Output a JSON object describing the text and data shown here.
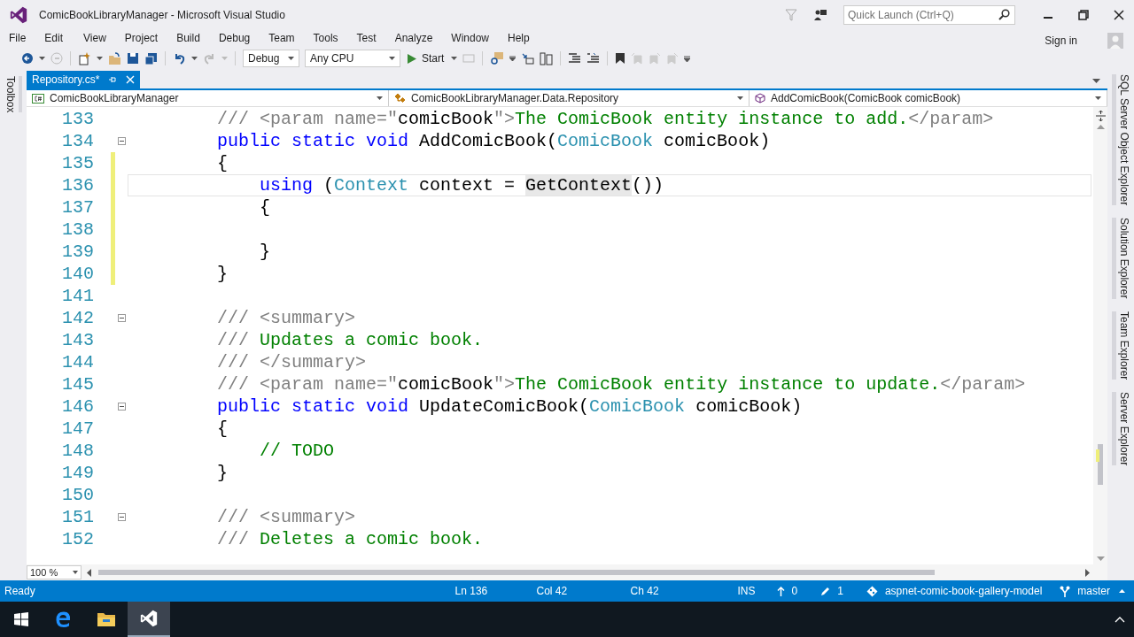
{
  "window": {
    "title": "ComicBookLibraryManager - Microsoft Visual Studio"
  },
  "quick_launch": {
    "placeholder": "Quick Launch (Ctrl+Q)"
  },
  "sign_in": "Sign in",
  "menu": [
    "File",
    "Edit",
    "View",
    "Project",
    "Build",
    "Debug",
    "Team",
    "Tools",
    "Test",
    "Analyze",
    "Window",
    "Help"
  ],
  "toolbar": {
    "configuration": "Debug",
    "platform": "Any CPU",
    "start": "Start"
  },
  "tabs": [
    {
      "label": "Repository.cs*",
      "selected": true
    }
  ],
  "navigation": {
    "project": "ComicBookLibraryManager",
    "type": "ComicBookLibraryManager.Data.Repository",
    "member": "AddComicBook(ComicBook comicBook)"
  },
  "left_panels": [
    "Toolbox"
  ],
  "right_panels": [
    "SQL Server Object Explorer",
    "Solution Explorer",
    "Team Explorer",
    "Server Explorer"
  ],
  "editor": {
    "zoom": "100 %",
    "lines": [
      {
        "number": "133",
        "changed": false,
        "current": false,
        "foldable": false,
        "kind": "member",
        "tokens": [
          {
            "kind": "doc",
            "text": "/// <param name=\""
          },
          {
            "kind": "plain",
            "text": "comicBook"
          },
          {
            "kind": "doc",
            "text": "\">"
          },
          {
            "kind": "comment",
            "text": "The ComicBook entity instance to add."
          },
          {
            "kind": "doc",
            "text": "</param>"
          }
        ]
      },
      {
        "number": "134",
        "changed": false,
        "current": false,
        "foldable": true,
        "kind": "member",
        "tokens": [
          {
            "kind": "keyword",
            "text": "public static void"
          },
          {
            "kind": "plain",
            "text": " AddComicBook("
          },
          {
            "kind": "type",
            "text": "ComicBook"
          },
          {
            "kind": "plain",
            "text": " comicBook)"
          }
        ]
      },
      {
        "number": "135",
        "changed": true,
        "current": false,
        "foldable": false,
        "kind": "member",
        "tokens": [
          {
            "kind": "plain",
            "text": "{"
          }
        ]
      },
      {
        "number": "136",
        "changed": true,
        "current": true,
        "foldable": false,
        "kind": "statement",
        "tokens": [
          {
            "kind": "keyword",
            "text": "using"
          },
          {
            "kind": "plain",
            "text": " ("
          },
          {
            "kind": "type",
            "text": "Context"
          },
          {
            "kind": "plain",
            "text": " context = "
          },
          {
            "kind": "highlight",
            "text": "GetContext"
          },
          {
            "kind": "plain",
            "text": "())"
          }
        ]
      },
      {
        "number": "137",
        "changed": true,
        "current": false,
        "foldable": false,
        "kind": "statement",
        "tokens": [
          {
            "kind": "plain",
            "text": "{"
          }
        ]
      },
      {
        "number": "138",
        "changed": true,
        "current": false,
        "foldable": false
      },
      {
        "number": "139",
        "changed": true,
        "current": false,
        "foldable": false,
        "kind": "statement",
        "tokens": [
          {
            "kind": "plain",
            "text": "}"
          }
        ]
      },
      {
        "number": "140",
        "changed": true,
        "current": false,
        "foldable": false,
        "kind": "member",
        "tokens": [
          {
            "kind": "plain",
            "text": "}"
          }
        ]
      },
      {
        "number": "141",
        "changed": false,
        "current": false,
        "foldable": false
      },
      {
        "number": "142",
        "changed": false,
        "current": false,
        "foldable": true,
        "kind": "member",
        "tokens": [
          {
            "kind": "doc",
            "text": "/// <summary>"
          }
        ]
      },
      {
        "number": "143",
        "changed": false,
        "current": false,
        "foldable": false,
        "kind": "member",
        "tokens": [
          {
            "kind": "doc",
            "text": "/// "
          },
          {
            "kind": "comment",
            "text": "Updates a comic book."
          }
        ]
      },
      {
        "number": "144",
        "changed": false,
        "current": false,
        "foldable": false,
        "kind": "member",
        "tokens": [
          {
            "kind": "doc",
            "text": "/// </summary>"
          }
        ]
      },
      {
        "number": "145",
        "changed": false,
        "current": false,
        "foldable": false,
        "kind": "member",
        "tokens": [
          {
            "kind": "doc",
            "text": "/// <param name=\""
          },
          {
            "kind": "plain",
            "text": "comicBook"
          },
          {
            "kind": "doc",
            "text": "\">"
          },
          {
            "kind": "comment",
            "text": "The ComicBook entity instance to update."
          },
          {
            "kind": "doc",
            "text": "</param>"
          }
        ]
      },
      {
        "number": "146",
        "changed": false,
        "current": false,
        "foldable": true,
        "kind": "member",
        "tokens": [
          {
            "kind": "keyword",
            "text": "public static void"
          },
          {
            "kind": "plain",
            "text": " UpdateComicBook("
          },
          {
            "kind": "type",
            "text": "ComicBook"
          },
          {
            "kind": "plain",
            "text": " comicBook)"
          }
        ]
      },
      {
        "number": "147",
        "changed": false,
        "current": false,
        "foldable": false,
        "kind": "member",
        "tokens": [
          {
            "kind": "plain",
            "text": "{"
          }
        ]
      },
      {
        "number": "148",
        "changed": false,
        "current": false,
        "foldable": false,
        "kind": "statement",
        "tokens": [
          {
            "kind": "comment",
            "text": "// TODO"
          }
        ]
      },
      {
        "number": "149",
        "changed": false,
        "current": false,
        "foldable": false,
        "kind": "member",
        "tokens": [
          {
            "kind": "plain",
            "text": "}"
          }
        ]
      },
      {
        "number": "150",
        "changed": false,
        "current": false,
        "foldable": false
      },
      {
        "number": "151",
        "changed": false,
        "current": false,
        "foldable": true,
        "kind": "member",
        "tokens": [
          {
            "kind": "doc",
            "text": "/// <summary>"
          }
        ]
      },
      {
        "number": "152",
        "changed": false,
        "current": false,
        "foldable": false,
        "kind": "member",
        "tokens": [
          {
            "kind": "doc",
            "text": "/// "
          },
          {
            "kind": "comment",
            "text": "Deletes a comic book."
          }
        ]
      }
    ]
  },
  "status_bar": {
    "state": "Ready",
    "line": "Ln 136",
    "column": "Col 42",
    "character": "Ch 42",
    "mode": "INS",
    "pushes": "0",
    "edits": "1",
    "repository": "aspnet-comic-book-gallery-model",
    "branch": "master"
  },
  "taskbar": [
    {
      "kind": "start",
      "selected": false
    },
    {
      "kind": "browser",
      "selected": false
    },
    {
      "kind": "folder",
      "selected": false
    },
    {
      "kind": "studio",
      "selected": true
    }
  ]
}
